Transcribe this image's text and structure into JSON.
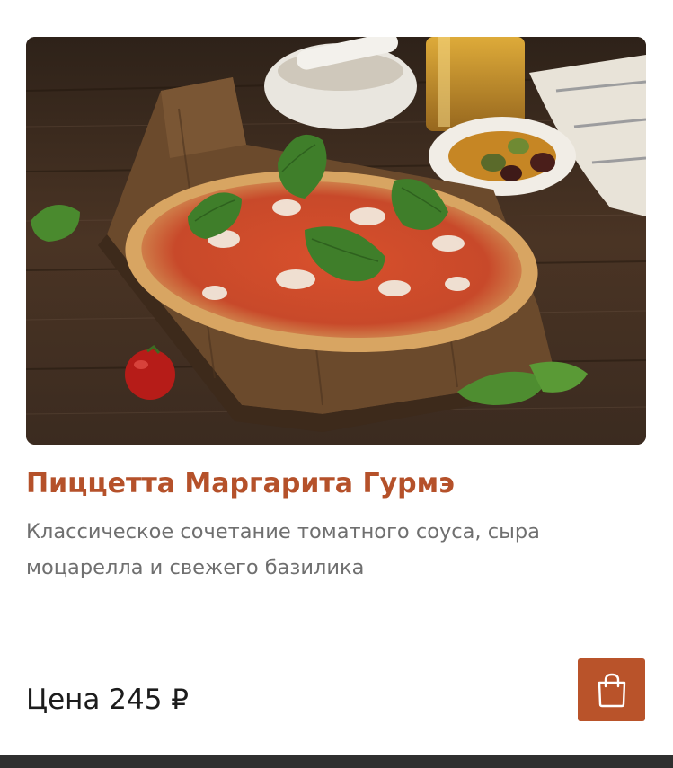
{
  "product": {
    "title": "Пиццетта Маргарита Гурмэ",
    "description": "Классическое сочетание томатного соуса, сыра моцарелла и свежего базилика",
    "price_text": "Цена 245 ₽",
    "image_alt": "pizza-photo"
  },
  "actions": {
    "add_to_cart_icon": "shopping-bag-icon"
  },
  "colors": {
    "accent": "#b9532a",
    "title": "#b5512a",
    "description": "#6f6f6f",
    "price": "#1c1c1c",
    "bottom_bar": "#2f2f2f"
  }
}
